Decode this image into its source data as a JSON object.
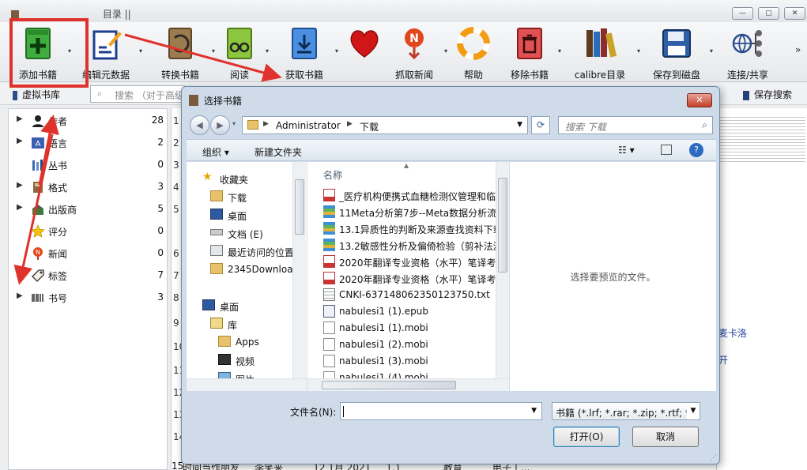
{
  "window": {
    "title": "目录 ||",
    "controls": [
      "minimize",
      "maximize",
      "close"
    ]
  },
  "toolbar": {
    "items": [
      {
        "label": "添加书籍",
        "icon": "add-book-icon"
      },
      {
        "label": "编辑元数据",
        "icon": "edit-metadata-icon"
      },
      {
        "label": "转换书籍",
        "icon": "convert-book-icon"
      },
      {
        "label": "阅读",
        "icon": "read-book-icon"
      },
      {
        "label": "获取书籍",
        "icon": "get-books-icon"
      },
      {
        "label": "",
        "icon": "heart-icon"
      },
      {
        "label": "抓取新闻",
        "icon": "fetch-news-icon"
      },
      {
        "label": "帮助",
        "icon": "help-lifebuoy-icon"
      },
      {
        "label": "移除书籍",
        "icon": "remove-book-icon"
      },
      {
        "label": "calibre目录",
        "icon": "calibre-library-icon"
      },
      {
        "label": "保存到磁盘",
        "icon": "save-disk-icon"
      },
      {
        "label": "连接/共享",
        "icon": "connect-share-icon"
      }
    ],
    "overflow": "»"
  },
  "searchrow": {
    "virtual_library": "虚拟书库",
    "search_placeholder": "搜索 （对于高级",
    "saved_search": "保存搜索"
  },
  "tag_browser": [
    {
      "label": "作者",
      "count": "28",
      "icon": "author-icon"
    },
    {
      "label": "语言",
      "count": "2",
      "icon": "language-icon"
    },
    {
      "label": "丛书",
      "count": "0",
      "icon": "series-icon"
    },
    {
      "label": "格式",
      "count": "3",
      "icon": "format-icon"
    },
    {
      "label": "出版商",
      "count": "5",
      "icon": "publisher-icon"
    },
    {
      "label": "评分",
      "count": "0",
      "icon": "rating-star-icon"
    },
    {
      "label": "新闻",
      "count": "0",
      "icon": "news-icon"
    },
    {
      "label": "标签",
      "count": "7",
      "icon": "tag-icon"
    },
    {
      "label": "书号",
      "count": "3",
      "icon": "isbn-barcode-icon"
    }
  ],
  "booklist": {
    "row_numbers": [
      "1",
      "2",
      "3",
      "4",
      "5",
      "6",
      "7",
      "8",
      "9",
      "10",
      "11",
      "12",
      "13",
      "14",
      "15"
    ],
    "peek_rows": [
      "",
      "",
      "",
      "",
      "",
      "",
      "",
      "",
      "",
      "",
      "",
      "",
      "",
      "",
      "把时间当作朋友     李笑来          12 1月 2021     1.1              教育          电子工..."
    ]
  },
  "detail": {
    "side_text_1": "麦卡洛",
    "side_text_2": "开"
  },
  "dialog": {
    "title": "选择书籍",
    "path": [
      "Administrator",
      "下载"
    ],
    "search_placeholder": "搜索 下载",
    "organize": "组织 ▾",
    "new_folder": "新建文件夹",
    "nav": [
      {
        "label": "收藏夹",
        "icon": "favorites-star-icon",
        "indent": 0
      },
      {
        "label": "下载",
        "icon": "downloads-folder-icon",
        "indent": 1
      },
      {
        "label": "桌面",
        "icon": "desktop-icon",
        "indent": 1
      },
      {
        "label": "文档 (E)",
        "icon": "drive-icon",
        "indent": 1
      },
      {
        "label": "最近访问的位置",
        "icon": "recent-places-icon",
        "indent": 1
      },
      {
        "label": "2345Downloads",
        "icon": "folder-icon",
        "indent": 1
      },
      {
        "label": "",
        "icon": "",
        "indent": 0
      },
      {
        "label": "桌面",
        "icon": "desktop-icon",
        "indent": 0
      },
      {
        "label": "库",
        "icon": "library-icon",
        "indent": 1
      },
      {
        "label": "Apps",
        "icon": "folder-icon",
        "indent": 2
      },
      {
        "label": "视频",
        "icon": "video-icon",
        "indent": 2
      },
      {
        "label": "图片",
        "icon": "pictures-icon",
        "indent": 2
      }
    ],
    "file_column": "名称",
    "files": [
      {
        "name": "_医疗机构便携式血糖检测仪管理和临床操作",
        "icon": "pdf-file-icon"
      },
      {
        "name": "11Meta分析第7步--Meta数据分析流程",
        "icon": "archive-file-icon"
      },
      {
        "name": "13.1异质性的判断及来源查找资料下载",
        "icon": "archive-file-icon"
      },
      {
        "name": "13.2敏感性分析及偏倚检验（剪补法源",
        "icon": "archive-file-icon"
      },
      {
        "name": "2020年翻译专业资格（水平）笔译考试",
        "icon": "pdf-file-icon"
      },
      {
        "name": "2020年翻译专业资格（水平）笔译考试",
        "icon": "pdf-file-icon"
      },
      {
        "name": "CNKI-637148062350123750.txt",
        "icon": "text-file-icon"
      },
      {
        "name": "nabulesi1 (1).epub",
        "icon": "epub-file-icon"
      },
      {
        "name": "nabulesi1 (1).mobi",
        "icon": "blank-file-icon"
      },
      {
        "name": "nabulesi1 (2).mobi",
        "icon": "blank-file-icon"
      },
      {
        "name": "nabulesi1 (3).mobi",
        "icon": "blank-file-icon"
      },
      {
        "name": "nabulesi1 (4).mobi",
        "icon": "blank-file-icon"
      }
    ],
    "preview_text": "选择要预览的文件。",
    "filename_label": "文件名(N):",
    "filename_value": "",
    "filter": "书籍 (*.lrf; *.rar; *.zip; *.rtf; *.li",
    "open_button": "打开(O)",
    "cancel_button": "取消"
  },
  "colors": {
    "annotation_red": "#e0322c",
    "dialog_frame": "#cfdbe8",
    "selection_blue": "#3b6db0"
  }
}
